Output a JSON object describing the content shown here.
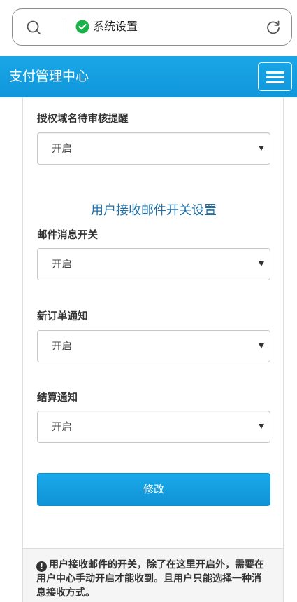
{
  "browser": {
    "address_text": "系统设置"
  },
  "navbar": {
    "title": "支付管理中心"
  },
  "form": {
    "auth_domain_label": "授权域名待审核提醒",
    "auth_domain_value": "开启",
    "section_title": "用户接收邮件开关设置",
    "mail_switch_label": "邮件消息开关",
    "mail_switch_value": "开启",
    "new_order_label": "新订单通知",
    "new_order_value": "开启",
    "settlement_label": "结算通知",
    "settlement_value": "开启",
    "submit_label": "修改"
  },
  "notice": {
    "text": "用户接收邮件的开关，除了在这里开启外，需要在用户中心手动开启才能收到。且用户只能选择一种消息接收方式。"
  },
  "colors": {
    "primary": "#1aa7e8",
    "section_title": "#1f6fa6",
    "shield_green": "#1ab34a"
  },
  "icons": [
    "search-icon",
    "shield-check-icon",
    "reload-icon",
    "menu-icon",
    "info-icon",
    "dropdown-arrow-icon"
  ]
}
